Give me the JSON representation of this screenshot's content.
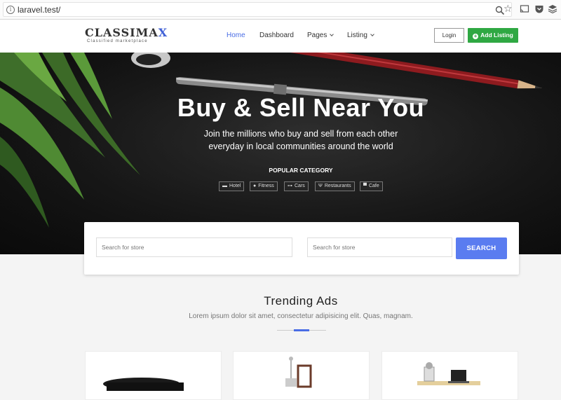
{
  "browser": {
    "url": "laravel.test/",
    "info_icon": "info-icon",
    "zoom_icon": "magnifier-icon",
    "bookmark_icon": "star-icon",
    "extensions": [
      "cast-icon",
      "pocket-icon",
      "layers-icon"
    ]
  },
  "nav": {
    "logo_main": "CLASSIMA",
    "logo_accent": "X",
    "logo_tagline": "Classified marketplace",
    "links": [
      {
        "label": "Home",
        "active": true
      },
      {
        "label": "Dashboard",
        "active": false
      },
      {
        "label": "Pages",
        "dropdown": true
      },
      {
        "label": "Listing",
        "dropdown": true
      }
    ],
    "login_label": "Login",
    "add_listing_label": "Add Listing"
  },
  "hero": {
    "title": "Buy & Sell Near You",
    "subtitle_line1": "Join the millions who buy and sell from each other",
    "subtitle_line2": "everyday in local communities around the world",
    "popular_label": "POPULAR CATEGORY",
    "categories": [
      {
        "label": "Hotel",
        "icon": "bed-icon"
      },
      {
        "label": "Fitness",
        "icon": "fitness-icon"
      },
      {
        "label": "Cars",
        "icon": "car-icon"
      },
      {
        "label": "Restaurants",
        "icon": "utensils-icon"
      },
      {
        "label": "Cafe",
        "icon": "coffee-icon"
      }
    ]
  },
  "search": {
    "placeholder_1": "Search for store",
    "placeholder_2": "Search for store",
    "button_label": "SEARCH"
  },
  "trending": {
    "title": "Trending Ads",
    "subtitle": "Lorem ipsum dolor sit amet, consectetur adipisicing elit. Quas, magnam."
  },
  "colors": {
    "accent_blue": "#4a6de5",
    "search_button": "#5a7cf0",
    "add_listing_green": "#2fa843"
  }
}
